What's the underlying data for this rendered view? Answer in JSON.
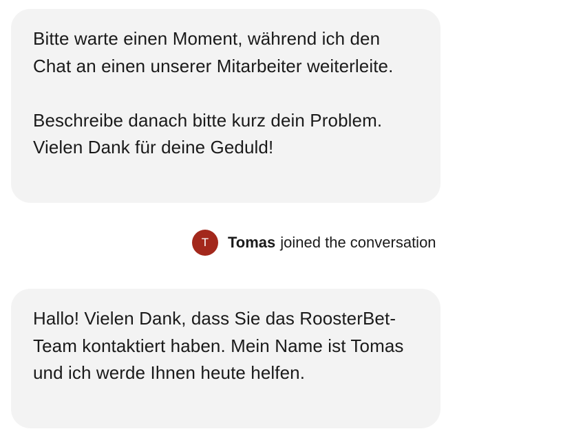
{
  "colors": {
    "bubble_background": "#f3f3f3",
    "avatar_background": "#a3281c",
    "text": "#1a1a1a"
  },
  "messages": [
    {
      "paragraphs": [
        "Bitte warte einen Moment, während ich den Chat an einen unserer Mitarbeiter weiterleite.",
        "Beschreibe danach bitte kurz dein Problem. Vielen Dank für deine Geduld!"
      ]
    },
    {
      "paragraphs": [
        "Hallo! Vielen Dank, dass Sie das RoosterBet-Team kontaktiert haben. Mein Name ist Tomas und ich werde Ihnen heute helfen."
      ]
    }
  ],
  "join_event": {
    "avatar_initial": "T",
    "agent_name": "Tomas",
    "text": "joined the conversation"
  }
}
